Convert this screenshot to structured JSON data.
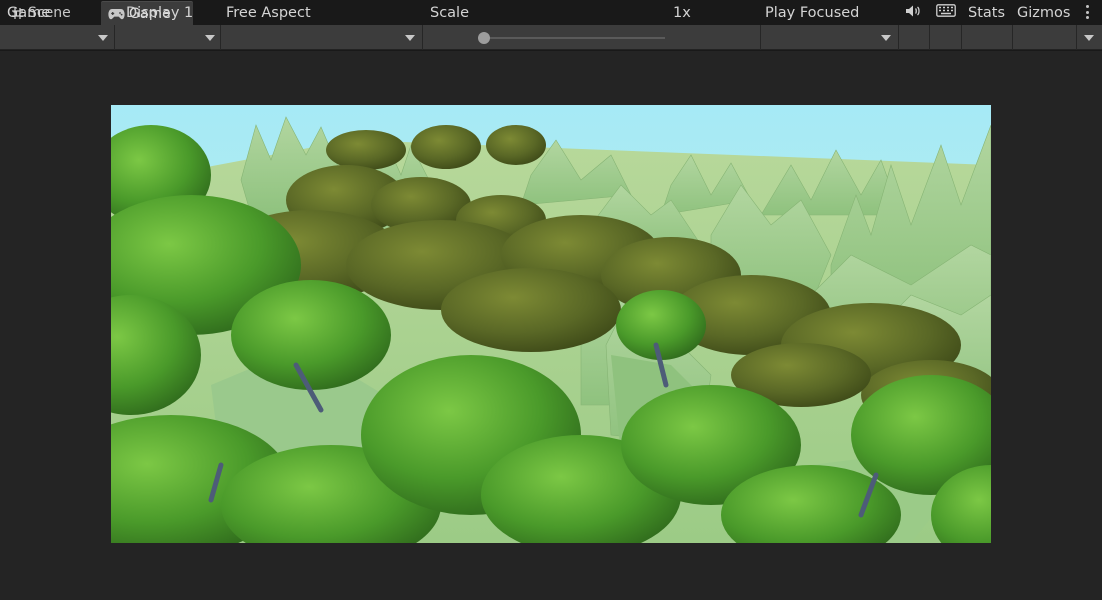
{
  "tabs": [
    {
      "label": "Scene",
      "icon": "grid-icon"
    },
    {
      "label": "Game",
      "icon": "gamepad-icon",
      "active": true
    }
  ],
  "toolbar": {
    "view_mode": "Game",
    "display": "Display 1",
    "aspect": "Free Aspect",
    "scale_label": "Scale",
    "scale_value": "1x",
    "scale_level": 0,
    "play_mode": "Play Focused",
    "audio_icon": "speaker-icon",
    "keyboard_icon": "keyboard-icon",
    "stats_label": "Stats",
    "gizmos_label": "Gizmos"
  },
  "colors": {
    "editor_bg": "#191919",
    "toolbar_bg": "#3c3c3c",
    "viewport_bg": "#242424",
    "sky": "#a8ebf5",
    "terrain": "#9cc98a",
    "foliage_dark": "#5a6b26",
    "foliage_light": "#4c9a2a"
  }
}
